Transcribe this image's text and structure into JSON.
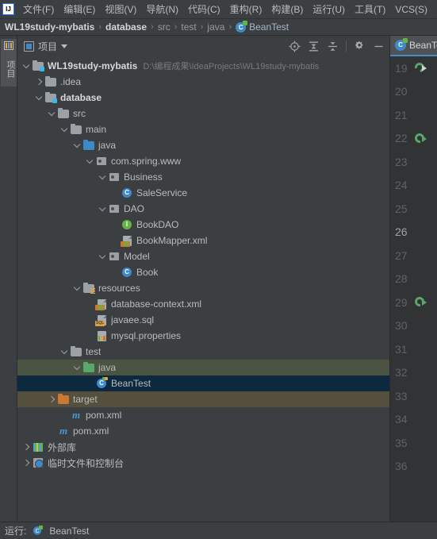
{
  "menubar": {
    "logo": "ij-logo",
    "items": [
      {
        "label": "文件(F)",
        "mnemonic": "F"
      },
      {
        "label": "编辑(E)",
        "mnemonic": "E"
      },
      {
        "label": "视图(V)",
        "mnemonic": "V"
      },
      {
        "label": "导航(N)",
        "mnemonic": "N"
      },
      {
        "label": "代码(C)",
        "mnemonic": "C"
      },
      {
        "label": "重构(R)",
        "mnemonic": "R"
      },
      {
        "label": "构建(B)",
        "mnemonic": "B"
      },
      {
        "label": "运行(U)",
        "mnemonic": "U"
      },
      {
        "label": "工具(T)",
        "mnemonic": "T"
      },
      {
        "label": "VCS(S)",
        "mnemonic": "S"
      }
    ]
  },
  "breadcrumb": {
    "separator": "›",
    "items": [
      {
        "label": "WL19study-mybatis",
        "style": "bold"
      },
      {
        "label": "database",
        "style": "bold"
      },
      {
        "label": "src",
        "style": "dim"
      },
      {
        "label": "test",
        "style": "dim"
      },
      {
        "label": "java",
        "style": "dim"
      },
      {
        "label": "BeanTest",
        "style": "normal",
        "icon": "test-class-icon"
      }
    ]
  },
  "leftstrip": {
    "tab_label": "项目"
  },
  "project_panel": {
    "title": "项目",
    "title_icon": "project-icon",
    "dropdown_icon": "chevron-down-icon",
    "tools": [
      {
        "name": "locate-icon",
        "title": "选择打开的文件"
      },
      {
        "name": "expand-all-icon",
        "title": "全部展开"
      },
      {
        "name": "collapse-all-icon",
        "title": "全部折叠"
      },
      {
        "name": "settings-gear-icon",
        "title": "设置"
      },
      {
        "name": "hide-icon",
        "title": "隐藏"
      }
    ]
  },
  "tree": {
    "nodes": [
      {
        "indent": 0,
        "arrow": "down",
        "icon": "folder-module",
        "label": "WL19study-mybatis",
        "bold": true,
        "path": "D:\\编程成果\\IdeaProjects\\WL19study-mybatis",
        "state": "normal"
      },
      {
        "indent": 1,
        "arrow": "right",
        "icon": "folder-grey",
        "label": ".idea",
        "bold": false,
        "path": "",
        "state": "normal"
      },
      {
        "indent": 1,
        "arrow": "down",
        "icon": "folder-module",
        "label": "database",
        "bold": true,
        "path": "",
        "state": "normal"
      },
      {
        "indent": 2,
        "arrow": "down",
        "icon": "folder-grey",
        "label": "src",
        "bold": false,
        "path": "",
        "state": "normal"
      },
      {
        "indent": 3,
        "arrow": "down",
        "icon": "folder-grey",
        "label": "main",
        "bold": false,
        "path": "",
        "state": "normal"
      },
      {
        "indent": 4,
        "arrow": "down",
        "icon": "folder-blue",
        "label": "java",
        "bold": false,
        "path": "",
        "state": "normal"
      },
      {
        "indent": 5,
        "arrow": "down",
        "icon": "package",
        "label": "com.spring.www",
        "bold": false,
        "path": "",
        "state": "normal"
      },
      {
        "indent": 6,
        "arrow": "down",
        "icon": "package",
        "label": "Business",
        "bold": false,
        "path": "",
        "state": "normal"
      },
      {
        "indent": 7,
        "arrow": "none",
        "icon": "class",
        "label": "SaleService",
        "bold": false,
        "path": "",
        "state": "normal"
      },
      {
        "indent": 6,
        "arrow": "down",
        "icon": "package",
        "label": "DAO",
        "bold": false,
        "path": "",
        "state": "normal"
      },
      {
        "indent": 7,
        "arrow": "none",
        "icon": "interface",
        "label": "BookDAO",
        "bold": false,
        "path": "",
        "state": "normal"
      },
      {
        "indent": 7,
        "arrow": "none",
        "icon": "xml-spring",
        "label": "BookMapper.xml",
        "bold": false,
        "path": "",
        "state": "normal"
      },
      {
        "indent": 6,
        "arrow": "down",
        "icon": "package",
        "label": "Model",
        "bold": false,
        "path": "",
        "state": "normal"
      },
      {
        "indent": 7,
        "arrow": "none",
        "icon": "class",
        "label": "Book",
        "bold": false,
        "path": "",
        "state": "normal"
      },
      {
        "indent": 4,
        "arrow": "down",
        "icon": "folder-resources",
        "label": "resources",
        "bold": false,
        "path": "",
        "state": "normal"
      },
      {
        "indent": 5,
        "arrow": "none",
        "icon": "xml-spring",
        "label": "database-context.xml",
        "bold": false,
        "path": "",
        "state": "normal"
      },
      {
        "indent": 5,
        "arrow": "none",
        "icon": "sql",
        "label": "javaee.sql",
        "bold": false,
        "path": "",
        "state": "normal"
      },
      {
        "indent": 5,
        "arrow": "none",
        "icon": "properties",
        "label": "mysql.properties",
        "bold": false,
        "path": "",
        "state": "normal"
      },
      {
        "indent": 3,
        "arrow": "down",
        "icon": "folder-grey",
        "label": "test",
        "bold": false,
        "path": "",
        "state": "normal"
      },
      {
        "indent": 4,
        "arrow": "down",
        "icon": "folder-green",
        "label": "java",
        "bold": false,
        "path": "",
        "state": "testsrc"
      },
      {
        "indent": 5,
        "arrow": "none",
        "icon": "test-class",
        "label": "BeanTest",
        "bold": false,
        "path": "",
        "state": "selected"
      },
      {
        "indent": 2,
        "arrow": "right",
        "icon": "folder-orange",
        "label": "target",
        "bold": false,
        "path": "",
        "state": "excluded"
      },
      {
        "indent": 3,
        "arrow": "none",
        "icon": "maven",
        "label": "pom.xml",
        "bold": false,
        "path": "",
        "state": "normal"
      },
      {
        "indent": 2,
        "arrow": "none",
        "icon": "maven",
        "label": "pom.xml",
        "bold": false,
        "path": "",
        "state": "normal"
      },
      {
        "indent": 0,
        "arrow": "right",
        "icon": "library",
        "label": "外部库",
        "bold": false,
        "path": "",
        "state": "normal"
      },
      {
        "indent": 0,
        "arrow": "right",
        "icon": "scratch",
        "label": "临时文件和控制台",
        "bold": false,
        "path": "",
        "state": "normal"
      }
    ]
  },
  "editor": {
    "tab_label": "BeanTest",
    "tab_icon": "test-class-icon",
    "current_line": 26,
    "lines": [
      {
        "number": 19,
        "gutter_icon": "run-arrow"
      },
      {
        "number": 20,
        "gutter_icon": ""
      },
      {
        "number": 21,
        "gutter_icon": ""
      },
      {
        "number": 22,
        "gutter_icon": "run-test"
      },
      {
        "number": 23,
        "gutter_icon": ""
      },
      {
        "number": 24,
        "gutter_icon": ""
      },
      {
        "number": 25,
        "gutter_icon": ""
      },
      {
        "number": 26,
        "gutter_icon": ""
      },
      {
        "number": 27,
        "gutter_icon": ""
      },
      {
        "number": 28,
        "gutter_icon": ""
      },
      {
        "number": 29,
        "gutter_icon": "run-test"
      },
      {
        "number": 30,
        "gutter_icon": ""
      },
      {
        "number": 31,
        "gutter_icon": ""
      },
      {
        "number": 32,
        "gutter_icon": ""
      },
      {
        "number": 33,
        "gutter_icon": ""
      },
      {
        "number": 34,
        "gutter_icon": ""
      },
      {
        "number": 35,
        "gutter_icon": ""
      },
      {
        "number": 36,
        "gutter_icon": ""
      }
    ]
  },
  "statusbar": {
    "items": [
      {
        "label": "运行:",
        "icon": ""
      },
      {
        "label": "BeanTest",
        "icon": "test-class-icon"
      }
    ]
  },
  "colors": {
    "background": "#3c3f41",
    "editor_bg": "#313335",
    "selection": "#0d293f",
    "test_source_root": "#4b5343",
    "excluded": "#55503e",
    "accent_blue": "#3e8ac8",
    "accent_green": "#59a869",
    "accent_orange": "#cc7832",
    "text": "#bbbbbb",
    "text_dim": "#7a7a7a"
  }
}
